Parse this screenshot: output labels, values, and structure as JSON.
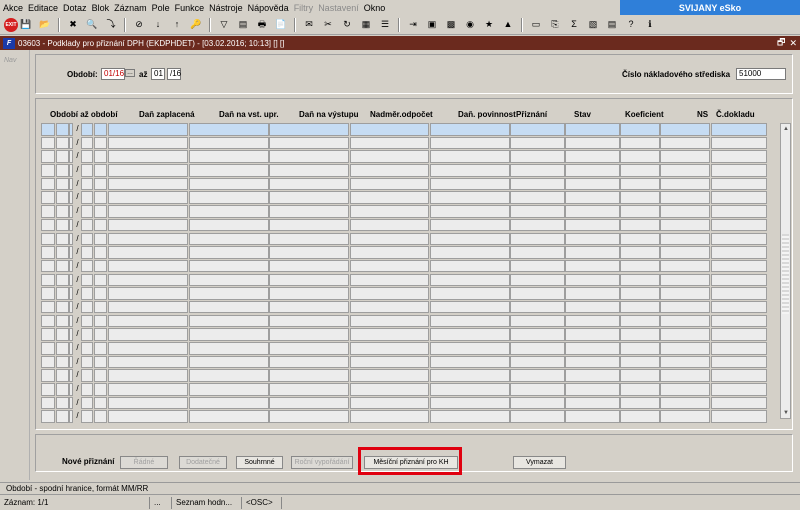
{
  "menu": {
    "items": [
      {
        "label": "Akce",
        "disabled": false
      },
      {
        "label": "Editace",
        "disabled": false
      },
      {
        "label": "Dotaz",
        "disabled": false
      },
      {
        "label": "Blok",
        "disabled": false
      },
      {
        "label": "Záznam",
        "disabled": false
      },
      {
        "label": "Pole",
        "disabled": false
      },
      {
        "label": "Funkce",
        "disabled": false
      },
      {
        "label": "Nástroje",
        "disabled": false
      },
      {
        "label": "Nápověda",
        "disabled": false
      },
      {
        "label": "Filtry",
        "disabled": true
      },
      {
        "label": "Nastavení",
        "disabled": true
      },
      {
        "label": "Okno",
        "disabled": false
      }
    ]
  },
  "brand": "SVIJANY eSko",
  "toolbar": {
    "exit_label": "EXIT",
    "icons": [
      "save-icon",
      "folder-icon",
      "clear-icon",
      "find-icon",
      "execute-query-icon",
      "cancel-query-icon",
      "sort-asc-icon",
      "sort-desc-icon",
      "key-icon",
      "filter-icon",
      "bars-icon",
      "print-icon",
      "doc-icon",
      "mail-icon",
      "cut-icon",
      "refresh-icon",
      "grid-icon",
      "list-icon",
      "export-icon",
      "calendar-icon",
      "calculator-icon",
      "globe-icon",
      "star-icon",
      "chart-icon",
      "window-icon",
      "copy-icon",
      "sum-icon",
      "excel-icon",
      "table-icon",
      "help-icon",
      "info-icon"
    ]
  },
  "window": {
    "title": "03603 - Podklady pro přiznání DPH (EKDPHDET) - [03.02.2016; 10:13] [] []",
    "nav_label": "Nav"
  },
  "header": {
    "obdobi_label": "Období:",
    "obdobi_from": "01/16",
    "az_label": "až",
    "obdobi_to_month": "01",
    "obdobi_to_year": "/16",
    "center_label": "Číslo nákladového střediska",
    "center_value": "51000"
  },
  "grid": {
    "columns": [
      "Období až období",
      "Daň zaplacená",
      "Daň na vst. upr.",
      "Daň na výstupu",
      "Nadměr.odpočet",
      "Daň. povinnost",
      "Přiznání",
      "Stav",
      "Koeficient",
      "NS",
      "Č.dokladu"
    ],
    "row_count": 22,
    "selected_row": 1
  },
  "actions": {
    "section_label": "Nové přiznání",
    "buttons": [
      {
        "label": "Řádné",
        "enabled": false
      },
      {
        "label": "Dodatečné",
        "enabled": false
      },
      {
        "label": "Souhrnné",
        "enabled": true
      },
      {
        "label": "Roční vypořádání",
        "enabled": false
      },
      {
        "label": "Měsíční přiznání pro KH",
        "enabled": true
      },
      {
        "label": "Vymazat",
        "enabled": true
      }
    ]
  },
  "hint": "Období - spodní hranice, formát MM/RR",
  "status": {
    "record": "Záznam: 1/1",
    "dots": "...",
    "list": "Seznam hodn...",
    "osc": "<OSC>"
  },
  "colors": {
    "highlight": "#e0000f",
    "title_bar": "#6b2a1e",
    "brand": "#2f7fd9",
    "selected_row": "#c6dcf3"
  }
}
